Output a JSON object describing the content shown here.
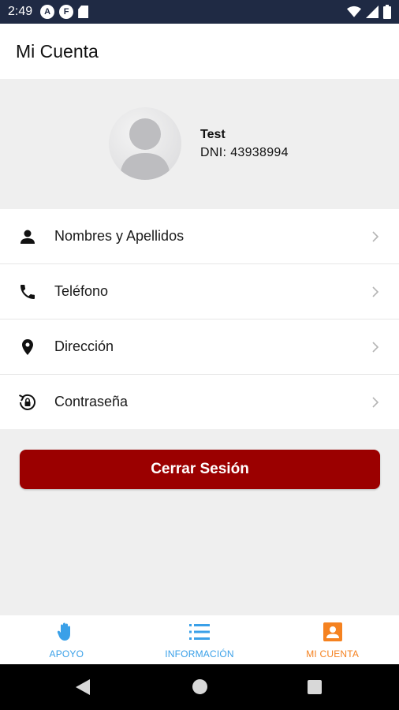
{
  "status_bar": {
    "time": "2:49",
    "badge_1": "A",
    "badge_2": "F"
  },
  "app_bar": {
    "title": "Mi Cuenta"
  },
  "profile": {
    "name": "Test",
    "dni_label": "DNI:",
    "dni_value": "43938994"
  },
  "menu": {
    "items": [
      {
        "label": "Nombres y Apellidos",
        "icon": "person-icon"
      },
      {
        "label": "Teléfono",
        "icon": "phone-icon"
      },
      {
        "label": "Dirección",
        "icon": "location-pin-icon"
      },
      {
        "label": "Contraseña",
        "icon": "password-reset-icon"
      }
    ]
  },
  "logout_label": "Cerrar Sesión",
  "bottom_nav": {
    "items": [
      {
        "label": "APOYO",
        "icon": "hand-icon",
        "color": "#3aa0e8",
        "active": false
      },
      {
        "label": "INFORMACIÓN",
        "icon": "list-icon",
        "color": "#3aa0e8",
        "active": false
      },
      {
        "label": "MI CUENTA",
        "icon": "account-box-icon",
        "color": "#f58220",
        "active": true
      }
    ]
  },
  "colors": {
    "status_bar": "#1f2a44",
    "logout_button": "#9b0000",
    "nav_inactive": "#3aa0e8",
    "nav_active": "#f58220"
  }
}
